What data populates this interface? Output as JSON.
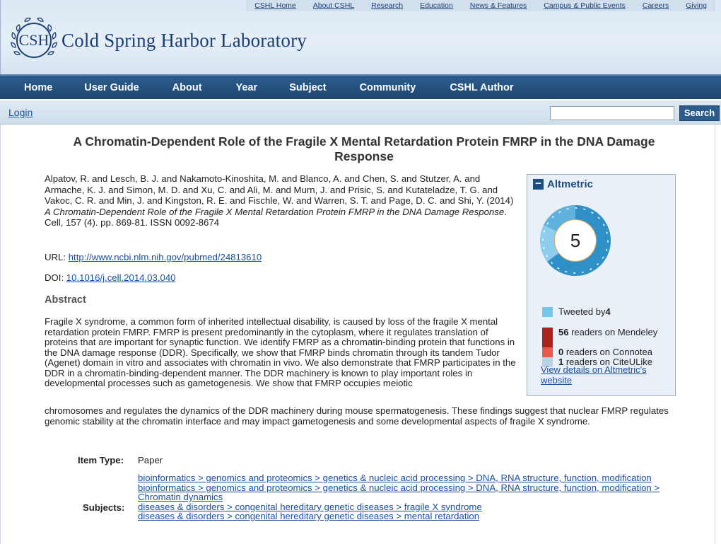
{
  "header": {
    "top_links": [
      "CSHL Home",
      "About CSHL",
      "Research",
      "Education",
      "News & Features",
      "Campus & Public Events",
      "Careers",
      "Giving"
    ],
    "logo_abbrev": "CSH",
    "logo_text": "Cold Spring Harbor Laboratory"
  },
  "nav": {
    "items": [
      "Home",
      "User Guide",
      "About",
      "Year",
      "Subject",
      "Community",
      "CSHL Author"
    ]
  },
  "loginbar": {
    "login_label": "Login",
    "search_value": "",
    "search_button": "Search"
  },
  "article": {
    "title": "A Chromatin-Dependent Role of the Fragile X Mental Retardation Protein FMRP in the DNA Damage Response",
    "citation_authors": "Alpatov, R. and Lesch, B. J. and Nakamoto-Kinoshita, M. and Blanco, A. and Chen, S. and Stutzer, A. and Armache, K. J. and Simon, M. D. and Xu, C. and Ali, M. and Murn, J. and Prisic, S. and Kutateladze, T. G. and Vakoc, C. R. and Min, J. and Kingston, R. E. and Fischle, W. and Warren, S. T. and Page, D. C. and Shi, Y. (2014) ",
    "citation_title": "A Chromatin-Dependent Role of the Fragile X Mental Retardation Protein FMRP in the DNA Damage Response",
    "citation_rest": ". Cell, 157 (4). pp. 869-81. ISSN 0092-8674",
    "url_label": "URL: ",
    "url": "http://www.ncbi.nlm.nih.gov/pubmed/24813610",
    "doi_label": "DOI: ",
    "doi": "10.1016/j.cell.2014.03.040",
    "abstract_heading": "Abstract",
    "abstract_part1": "Fragile X syndrome, a common form of inherited intellectual disability, is caused by loss of the fragile X mental retardation protein FMRP. FMRP is present predominantly in the cytoplasm, where it regulates translation of proteins that are important for synaptic function. We identify FMRP as a chromatin-binding protein that functions in the DNA damage response (DDR). Specifically, we show that FMRP binds chromatin through its tandem Tudor (Agenet) domain in vitro and associates with chromatin in vivo. We also demonstrate that FMRP participates in the DDR in a chromatin-binding-dependent manner. The DDR machinery is known to play important roles in developmental processes such as gametogenesis. We show that FMRP occupies meiotic",
    "abstract_part2": "chromosomes and regulates the dynamics of the DDR machinery during mouse spermatogenesis. These findings suggest that nuclear FMRP regulates genomic stability at the chromatin interface and may impact gametogenesis and some developmental aspects of fragile X syndrome."
  },
  "altmetric": {
    "title": "Altmetric",
    "score": "5",
    "tweeted_label": "Tweeted by ",
    "tweeted_count": "4",
    "mendeley_count": "56",
    "mendeley_label": " readers on Mendeley",
    "connotea_count": "0",
    "connotea_label": " readers on Connotea",
    "citeulike_count": "1",
    "citeulike_label": " readers on CiteULike",
    "details_link": "View details on Altmetric's website",
    "colors": {
      "twitter": "#74c6ea",
      "mendeley": "#a7231c",
      "connotea": "#ea5a4b",
      "citeulike": "#bcd0e6",
      "donut_ring": [
        "#2f8fc7",
        "#60b2de",
        "#8fcdee",
        "#e4a84a",
        "#f3c76b"
      ]
    }
  },
  "details": {
    "item_type_label": "Item Type:",
    "item_type_value": "Paper",
    "subjects_label": "Subjects:",
    "subjects": [
      "bioinformatics > genomics and proteomics > genetics & nucleic acid processing > DNA, RNA structure, function, modification",
      "bioinformatics > genomics and proteomics > genetics & nucleic acid processing > DNA, RNA structure, function, modification > Chromatin dynamics",
      "diseases & disorders > congenital hereditary genetic diseases > fragile X syndrome",
      "diseases & disorders > congenital hereditary genetic diseases > mental retardation"
    ]
  }
}
